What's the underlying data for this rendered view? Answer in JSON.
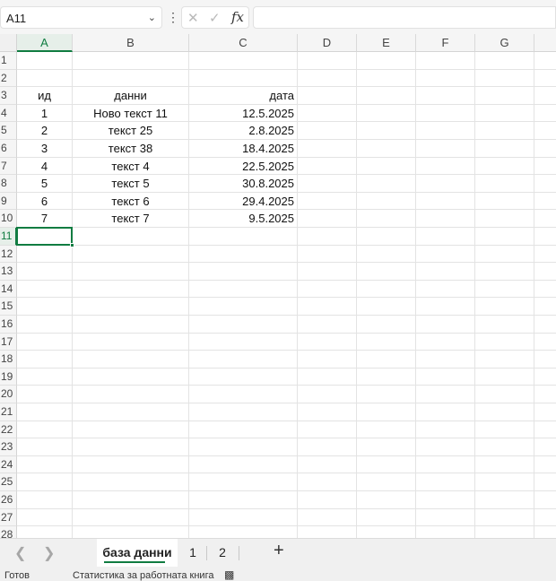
{
  "formula_bar": {
    "name_box": "A11",
    "formula": ""
  },
  "columns": [
    "A",
    "B",
    "C",
    "D",
    "E",
    "F",
    "G"
  ],
  "selected_column": "A",
  "selected_row": "11",
  "rows": [
    "1",
    "2",
    "3",
    "4",
    "5",
    "6",
    "7",
    "8",
    "9",
    "10",
    "11",
    "12",
    "13",
    "14",
    "15",
    "16",
    "17",
    "18",
    "19",
    "20",
    "21",
    "22",
    "23",
    "24",
    "25",
    "26",
    "27",
    "28"
  ],
  "sheet": {
    "headers": {
      "a": "ид",
      "b": "данни",
      "c": "дата"
    },
    "records": [
      {
        "a": "1",
        "b": "Ново текст 11",
        "c": "12.5.2025"
      },
      {
        "a": "2",
        "b": "текст 25",
        "c": "2.8.2025"
      },
      {
        "a": "3",
        "b": "текст 38",
        "c": "18.4.2025"
      },
      {
        "a": "4",
        "b": "текст 4",
        "c": "22.5.2025"
      },
      {
        "a": "5",
        "b": "текст 5",
        "c": "30.8.2025"
      },
      {
        "a": "6",
        "b": "текст 6",
        "c": "29.4.2025"
      },
      {
        "a": "7",
        "b": "текст 7",
        "c": "9.5.2025"
      }
    ]
  },
  "tabs": {
    "items": [
      "база данни",
      "1",
      "2"
    ],
    "active": "база данни",
    "add_label": "+"
  },
  "status": {
    "ready": "Готов",
    "stats": "Статистика за работната книга"
  },
  "colors": {
    "accent": "#107c41"
  }
}
